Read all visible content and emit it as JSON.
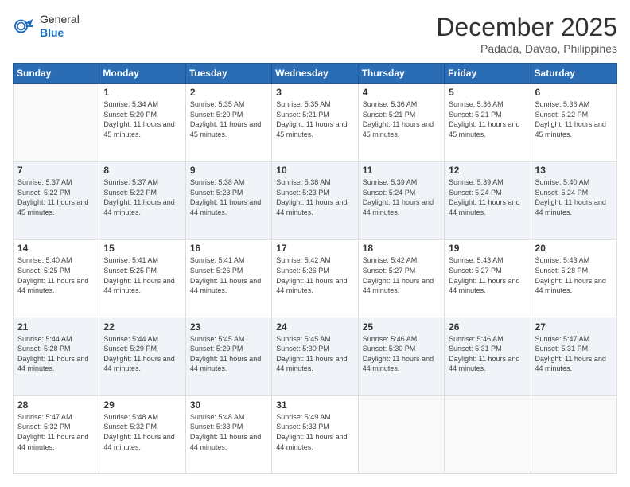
{
  "header": {
    "logo": {
      "general": "General",
      "blue": "Blue"
    },
    "title": "December 2025",
    "subtitle": "Padada, Davao, Philippines"
  },
  "calendar": {
    "days_of_week": [
      "Sunday",
      "Monday",
      "Tuesday",
      "Wednesday",
      "Thursday",
      "Friday",
      "Saturday"
    ],
    "weeks": [
      [
        {
          "day": "",
          "empty": true
        },
        {
          "day": "1",
          "sunrise": "5:34 AM",
          "sunset": "5:20 PM",
          "daylight": "11 hours and 45 minutes."
        },
        {
          "day": "2",
          "sunrise": "5:35 AM",
          "sunset": "5:20 PM",
          "daylight": "11 hours and 45 minutes."
        },
        {
          "day": "3",
          "sunrise": "5:35 AM",
          "sunset": "5:21 PM",
          "daylight": "11 hours and 45 minutes."
        },
        {
          "day": "4",
          "sunrise": "5:36 AM",
          "sunset": "5:21 PM",
          "daylight": "11 hours and 45 minutes."
        },
        {
          "day": "5",
          "sunrise": "5:36 AM",
          "sunset": "5:21 PM",
          "daylight": "11 hours and 45 minutes."
        },
        {
          "day": "6",
          "sunrise": "5:36 AM",
          "sunset": "5:22 PM",
          "daylight": "11 hours and 45 minutes."
        }
      ],
      [
        {
          "day": "7",
          "sunrise": "5:37 AM",
          "sunset": "5:22 PM",
          "daylight": "11 hours and 45 minutes."
        },
        {
          "day": "8",
          "sunrise": "5:37 AM",
          "sunset": "5:22 PM",
          "daylight": "11 hours and 44 minutes."
        },
        {
          "day": "9",
          "sunrise": "5:38 AM",
          "sunset": "5:23 PM",
          "daylight": "11 hours and 44 minutes."
        },
        {
          "day": "10",
          "sunrise": "5:38 AM",
          "sunset": "5:23 PM",
          "daylight": "11 hours and 44 minutes."
        },
        {
          "day": "11",
          "sunrise": "5:39 AM",
          "sunset": "5:24 PM",
          "daylight": "11 hours and 44 minutes."
        },
        {
          "day": "12",
          "sunrise": "5:39 AM",
          "sunset": "5:24 PM",
          "daylight": "11 hours and 44 minutes."
        },
        {
          "day": "13",
          "sunrise": "5:40 AM",
          "sunset": "5:24 PM",
          "daylight": "11 hours and 44 minutes."
        }
      ],
      [
        {
          "day": "14",
          "sunrise": "5:40 AM",
          "sunset": "5:25 PM",
          "daylight": "11 hours and 44 minutes."
        },
        {
          "day": "15",
          "sunrise": "5:41 AM",
          "sunset": "5:25 PM",
          "daylight": "11 hours and 44 minutes."
        },
        {
          "day": "16",
          "sunrise": "5:41 AM",
          "sunset": "5:26 PM",
          "daylight": "11 hours and 44 minutes."
        },
        {
          "day": "17",
          "sunrise": "5:42 AM",
          "sunset": "5:26 PM",
          "daylight": "11 hours and 44 minutes."
        },
        {
          "day": "18",
          "sunrise": "5:42 AM",
          "sunset": "5:27 PM",
          "daylight": "11 hours and 44 minutes."
        },
        {
          "day": "19",
          "sunrise": "5:43 AM",
          "sunset": "5:27 PM",
          "daylight": "11 hours and 44 minutes."
        },
        {
          "day": "20",
          "sunrise": "5:43 AM",
          "sunset": "5:28 PM",
          "daylight": "11 hours and 44 minutes."
        }
      ],
      [
        {
          "day": "21",
          "sunrise": "5:44 AM",
          "sunset": "5:28 PM",
          "daylight": "11 hours and 44 minutes."
        },
        {
          "day": "22",
          "sunrise": "5:44 AM",
          "sunset": "5:29 PM",
          "daylight": "11 hours and 44 minutes."
        },
        {
          "day": "23",
          "sunrise": "5:45 AM",
          "sunset": "5:29 PM",
          "daylight": "11 hours and 44 minutes."
        },
        {
          "day": "24",
          "sunrise": "5:45 AM",
          "sunset": "5:30 PM",
          "daylight": "11 hours and 44 minutes."
        },
        {
          "day": "25",
          "sunrise": "5:46 AM",
          "sunset": "5:30 PM",
          "daylight": "11 hours and 44 minutes."
        },
        {
          "day": "26",
          "sunrise": "5:46 AM",
          "sunset": "5:31 PM",
          "daylight": "11 hours and 44 minutes."
        },
        {
          "day": "27",
          "sunrise": "5:47 AM",
          "sunset": "5:31 PM",
          "daylight": "11 hours and 44 minutes."
        }
      ],
      [
        {
          "day": "28",
          "sunrise": "5:47 AM",
          "sunset": "5:32 PM",
          "daylight": "11 hours and 44 minutes."
        },
        {
          "day": "29",
          "sunrise": "5:48 AM",
          "sunset": "5:32 PM",
          "daylight": "11 hours and 44 minutes."
        },
        {
          "day": "30",
          "sunrise": "5:48 AM",
          "sunset": "5:33 PM",
          "daylight": "11 hours and 44 minutes."
        },
        {
          "day": "31",
          "sunrise": "5:49 AM",
          "sunset": "5:33 PM",
          "daylight": "11 hours and 44 minutes."
        },
        {
          "day": "",
          "empty": true
        },
        {
          "day": "",
          "empty": true
        },
        {
          "day": "",
          "empty": true
        }
      ]
    ]
  }
}
